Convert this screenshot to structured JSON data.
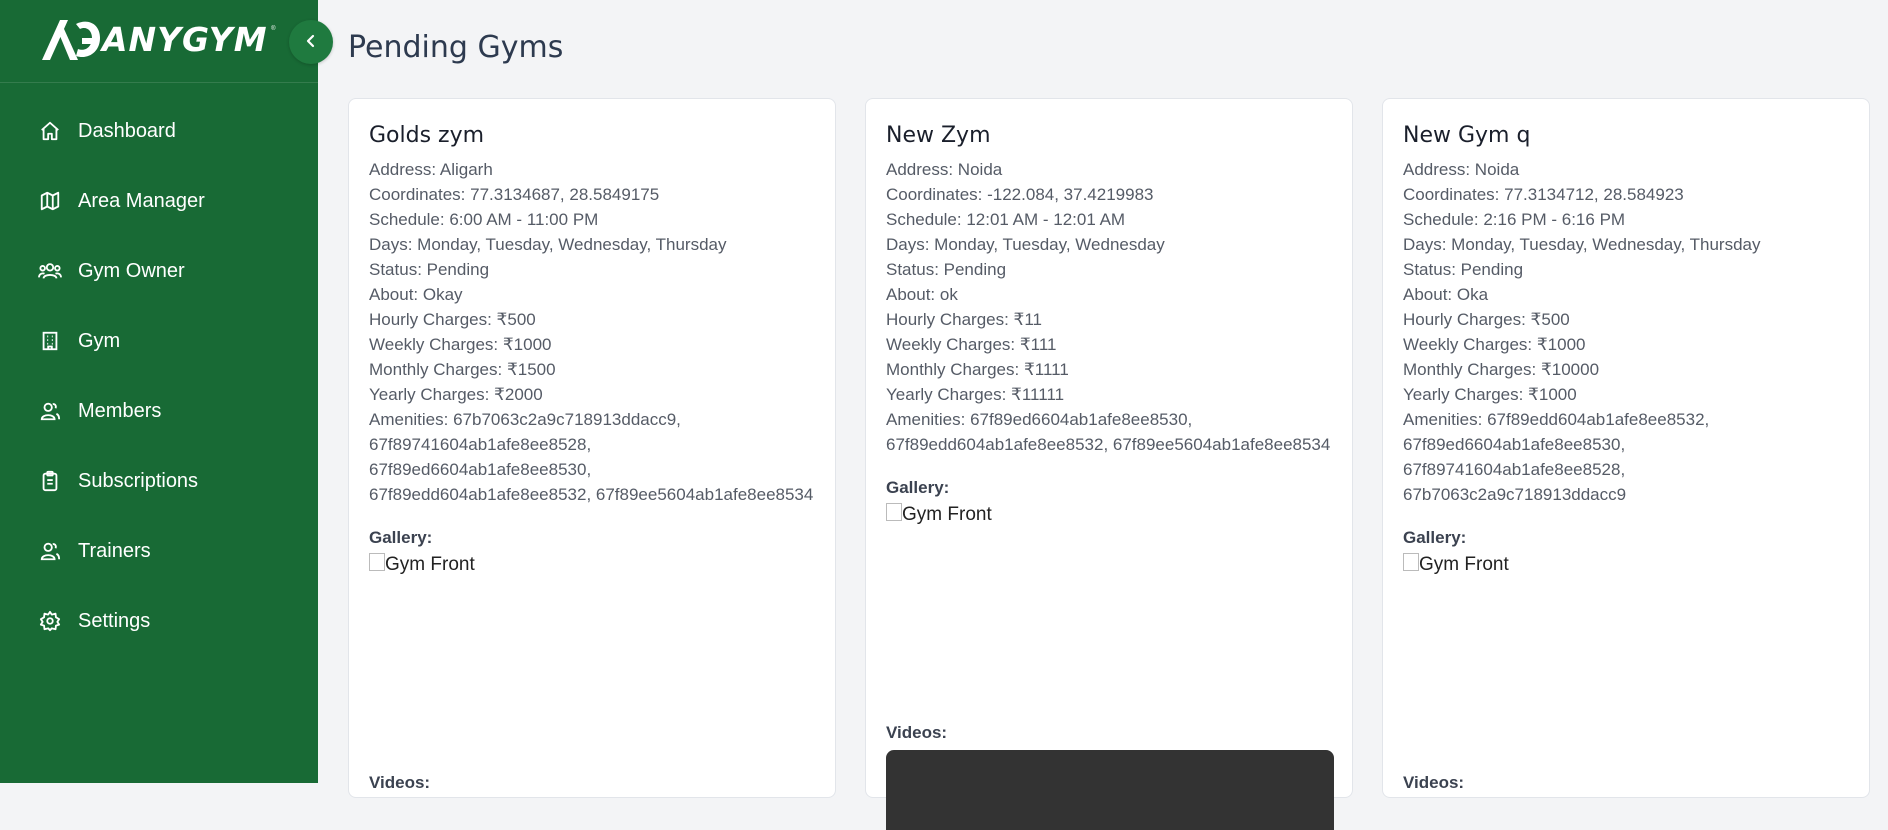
{
  "brand": {
    "name": "ANYGYM",
    "tm": "®"
  },
  "sidebar": {
    "items": [
      {
        "label": "Dashboard",
        "icon": "home-icon"
      },
      {
        "label": "Area Manager",
        "icon": "map-icon"
      },
      {
        "label": "Gym Owner",
        "icon": "users-icon"
      },
      {
        "label": "Gym",
        "icon": "building-icon"
      },
      {
        "label": "Members",
        "icon": "user-pair-icon"
      },
      {
        "label": "Subscriptions",
        "icon": "clipboard-icon"
      },
      {
        "label": "Trainers",
        "icon": "user-pair-icon"
      },
      {
        "label": "Settings",
        "icon": "gear-icon"
      }
    ]
  },
  "page": {
    "title": "Pending Gyms"
  },
  "labels": {
    "gallery": "Gallery:",
    "videos": "Videos:",
    "image_alt": "Gym Front"
  },
  "gyms": [
    {
      "name": "Golds zym",
      "address": "Address: Aligarh",
      "coordinates": "Coordinates: 77.3134687, 28.5849175",
      "schedule": "Schedule: 6:00 AM - 11:00 PM",
      "days": "Days: Monday, Tuesday, Wednesday, Thursday",
      "status": "Status: Pending",
      "about": "About: Okay",
      "hourly": "Hourly Charges: ₹500",
      "weekly": "Weekly Charges: ₹1000",
      "monthly": "Monthly Charges: ₹1500",
      "yearly": "Yearly Charges: ₹2000",
      "amenities": [
        "Amenities: 67b7063c2a9c718913ddacc9,",
        "67f89741604ab1afe8ee8528,",
        "67f89ed6604ab1afe8ee8530,",
        "67f89edd604ab1afe8ee8532, 67f89ee5604ab1afe8ee8534"
      ]
    },
    {
      "name": "New Zym",
      "address": "Address: Noida",
      "coordinates": "Coordinates: -122.084, 37.4219983",
      "schedule": "Schedule: 12:01 AM - 12:01 AM",
      "days": "Days: Monday, Tuesday, Wednesday",
      "status": "Status: Pending",
      "about": "About: ok",
      "hourly": "Hourly Charges: ₹11",
      "weekly": "Weekly Charges: ₹111",
      "monthly": "Monthly Charges: ₹1111",
      "yearly": "Yearly Charges: ₹11111",
      "amenities": [
        "Amenities: 67f89ed6604ab1afe8ee8530,",
        "67f89edd604ab1afe8ee8532, 67f89ee5604ab1afe8ee8534"
      ]
    },
    {
      "name": "New Gym q",
      "address": "Address: Noida",
      "coordinates": "Coordinates: 77.3134712, 28.584923",
      "schedule": "Schedule: 2:16 PM - 6:16 PM",
      "days": "Days: Monday, Tuesday, Wednesday, Thursday",
      "status": "Status: Pending",
      "about": "About: Oka",
      "hourly": "Hourly Charges: ₹500",
      "weekly": "Weekly Charges: ₹1000",
      "monthly": "Monthly Charges: ₹10000",
      "yearly": "Yearly Charges: ₹1000",
      "amenities": [
        "Amenities: 67f89edd604ab1afe8ee8532,",
        "67f89ed6604ab1afe8ee8530,",
        "67f89741604ab1afe8ee8528,",
        "67b7063c2a9c718913ddacc9"
      ]
    }
  ],
  "colors": {
    "sidebar": "#186a35",
    "background": "#f3f4f6",
    "card": "#ffffff"
  }
}
